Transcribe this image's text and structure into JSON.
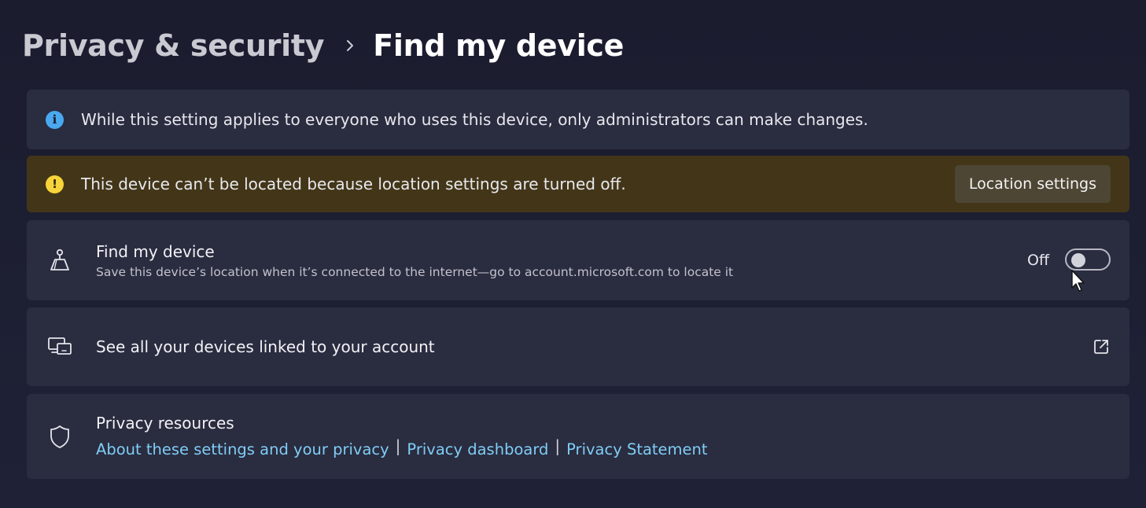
{
  "header": {
    "parent": "Privacy & security",
    "separator_icon": "chevron-right-icon",
    "current": "Find my device"
  },
  "info_bar": {
    "icon": "info-icon",
    "text": "While this setting applies to everyone who uses this device, only administrators can make changes."
  },
  "warning_bar": {
    "icon": "warning-icon",
    "text": "This device can’t be located because location settings are turned off.",
    "button_label": "Location settings"
  },
  "find_my_device": {
    "icon": "location-person-icon",
    "title": "Find my device",
    "description": "Save this device’s location when it’s connected to the internet—go to account.microsoft.com to locate it",
    "toggle_state_label": "Off",
    "toggle_on": false
  },
  "linked_devices": {
    "icon": "devices-icon",
    "title": "See all your devices linked to your account",
    "action_icon": "external-link-icon"
  },
  "privacy_resources": {
    "icon": "shield-icon",
    "title": "Privacy resources",
    "links": [
      "About these settings and your privacy",
      "Privacy dashboard",
      "Privacy Statement"
    ],
    "link_separator": "|"
  },
  "colors": {
    "background": "#1c1e31",
    "card": "#2a2c40",
    "warning_bg": "#433618",
    "info_accent": "#4aa8ef",
    "warning_accent": "#f7d43a",
    "link": "#7fcdf4"
  }
}
